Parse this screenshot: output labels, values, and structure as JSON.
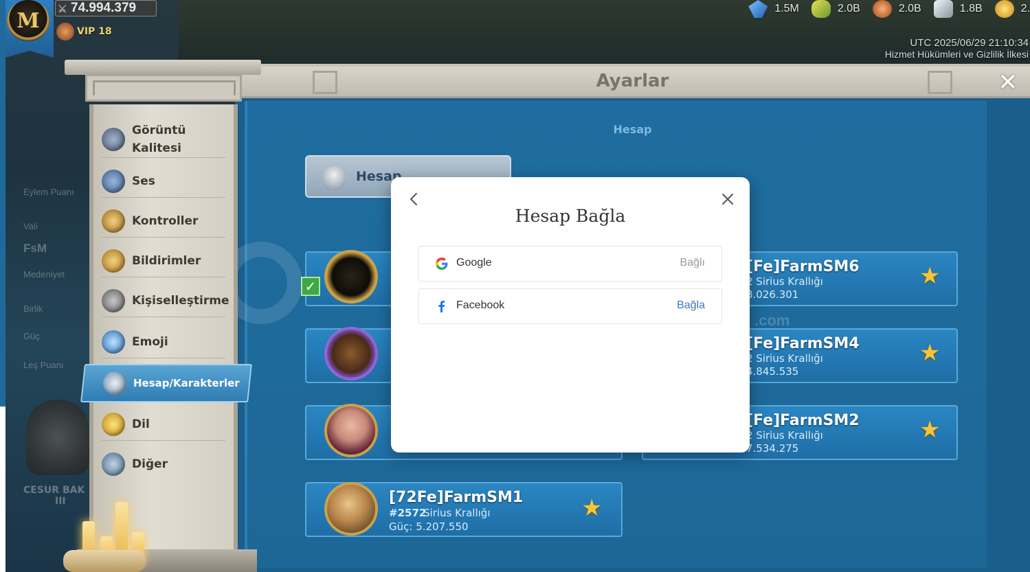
{
  "hud": {
    "avatar_letter": "M",
    "power": "74.994.379",
    "vip": "VIP 18",
    "resources": [
      {
        "icon": "gem-icon",
        "value": "1.5M",
        "color": "#3a8ee0"
      },
      {
        "icon": "corn-icon",
        "value": "2.0B",
        "color": "#b9c83a"
      },
      {
        "icon": "wood-icon",
        "value": "2.0B",
        "color": "#c8703a"
      },
      {
        "icon": "stone-icon",
        "value": "1.8B",
        "color": "#b9c0c8"
      },
      {
        "icon": "gold-coin-icon",
        "value": "2.",
        "color": "#e8b22a"
      }
    ],
    "utc": "UTC 2025/06/29 21:10:34",
    "terms": "Hizmet Hükümleri ve Gizlilik İlkesi"
  },
  "background": {
    "action_points": "Eylem Puanı",
    "vali": "Vali",
    "alliance_tag": "FsM",
    "medeniyet": "Medeniyet",
    "birlik": "Birlik",
    "guc": "Güç",
    "les_puani": "Leş Puanı",
    "crest_label": "CESUR BAK",
    "crest_level": "III"
  },
  "settings": {
    "title": "Ayarlar",
    "section": "Hesap",
    "account_tab": "Hesap",
    "sidebar": [
      {
        "label": "Görüntü\nKalitesi",
        "icon": "display-quality-icon",
        "color": "#7a8aa2"
      },
      {
        "label": "Ses",
        "icon": "sound-icon",
        "color": "#6a86b2"
      },
      {
        "label": "Kontroller",
        "icon": "controls-icon",
        "color": "#d6a84a"
      },
      {
        "label": "Bildirimler",
        "icon": "bell-icon",
        "color": "#d6a84a"
      },
      {
        "label": "Kişiselleştirme",
        "icon": "customize-icon",
        "color": "#8a8a8a"
      },
      {
        "label": "Emoji",
        "icon": "emoji-icon",
        "color": "#4a8ad2"
      },
      {
        "label": "Hesap/Karakterler",
        "icon": "account-icon",
        "color": "#9ab8d2",
        "active": true
      },
      {
        "label": "Dil",
        "icon": "language-icon",
        "color": "#e8b83a"
      },
      {
        "label": "Diğer",
        "icon": "other-icon",
        "color": "#8aa2c2"
      }
    ],
    "characters": [
      {
        "name": "[Fe]FarmSM6",
        "kingdom": "2 Sirius Krallığı",
        "power": "8.026.301"
      },
      {
        "name": "[Fe]FarmSM4",
        "kingdom": "2 Sirius Krallığı",
        "power": "4.845.535"
      },
      {
        "name": "[Fe]FarmSM2",
        "kingdom": "2 Sirius Krallığı",
        "power": "7.534.275"
      },
      {
        "name": "[72Fe]FarmSM1",
        "kingdom_id": "#2572",
        "kingdom": "Sirius Krallığı",
        "power": "Güç: 5.207.550"
      }
    ],
    "watermark": ".com"
  },
  "modal": {
    "title": "Hesap Bağla",
    "providers": [
      {
        "name": "Google",
        "action": "Bağlı",
        "icon": "google-icon"
      },
      {
        "name": "Facebook",
        "action": "Bağla",
        "icon": "facebook-icon"
      }
    ]
  }
}
